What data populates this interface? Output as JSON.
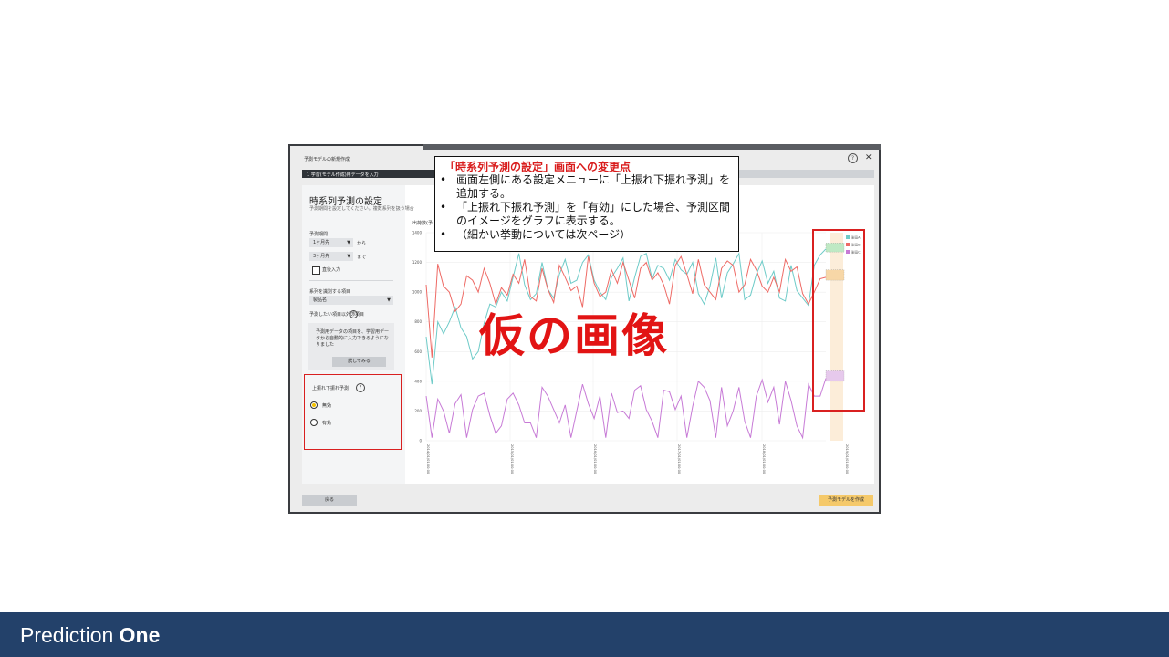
{
  "dialog": {
    "title": "予測モデルの新規作成",
    "step_label": "1 学習(モデル作成)用データを入力",
    "back_button": "戻る",
    "create_button": "予測モデルを作成"
  },
  "settings": {
    "title": "時系列予測の設定",
    "subtitle": "予測期間を設定してください。複数系列を扱う場合",
    "period_label": "予測期間",
    "period_from": "1ヶ月先",
    "from_suffix": "から",
    "period_to": "3ヶ月先",
    "to_suffix": "まで",
    "backtest_label": "直後入力",
    "series_label": "系列を識別する項目",
    "series_value": "製品名",
    "other_items_label": "予測したい項目以外の項目",
    "info_text": "予測用データの項目を、学習用データから自動的に入力できるようになりました",
    "try_button": "試してみる",
    "updown_label": "上振れ下振れ予測",
    "option_invalid": "無効",
    "option_valid": "有効"
  },
  "chart_label": "出荷数(予",
  "chart_data": {
    "type": "line",
    "ylabel": "出荷数(予",
    "ylim": [
      0,
      1400
    ],
    "yticks": [
      0,
      200,
      400,
      600,
      800,
      1000,
      1200,
      1400
    ],
    "xticks": [
      "2014/01/01 00:00",
      "2015/01/01 00:00",
      "2016/01/01 00:00",
      "2017/01/01 00:00",
      "2018/01/01 00:00",
      "2019/01/01 00:00"
    ],
    "grid": true,
    "legend_position": "top-right",
    "legend": [
      "製品A",
      "製品B",
      "製品C"
    ],
    "series": [
      {
        "name": "製品A",
        "color": "#6ecbc8",
        "values": [
          700,
          380,
          800,
          720,
          800,
          900,
          760,
          700,
          550,
          600,
          790,
          920,
          900,
          1000,
          940,
          1100,
          1260,
          1050,
          950,
          990,
          1200,
          1020,
          960,
          1120,
          1220,
          1060,
          1080,
          1200,
          1250,
          1080,
          1000,
          950,
          1100,
          1160,
          1230,
          940,
          1100,
          1240,
          1260,
          1090,
          1180,
          1160,
          1080,
          1220,
          1150,
          1120,
          1200,
          990,
          920,
          1040,
          1230,
          960,
          1130,
          1190,
          1260,
          950,
          980,
          1120,
          1210,
          1060,
          1140,
          960,
          940,
          1180,
          1010,
          960,
          910,
          1180,
          1250,
          1290
        ]
      },
      {
        "name": "製品B",
        "color": "#ee6a65",
        "values": [
          1050,
          560,
          1190,
          1040,
          1000,
          870,
          920,
          1110,
          1080,
          1000,
          1160,
          1060,
          920,
          1030,
          980,
          1120,
          1060,
          1220,
          970,
          940,
          1160,
          1020,
          930,
          1180,
          1100,
          1010,
          1040,
          900,
          1240,
          1060,
          970,
          1000,
          1150,
          1060,
          1200,
          1080,
          960,
          1160,
          1200,
          1080,
          1130,
          1050,
          920,
          1180,
          1240,
          1120,
          990,
          1220,
          1050,
          1000,
          950,
          1160,
          1210,
          1180,
          1000,
          1050,
          1220,
          1150,
          1040,
          1000,
          1100,
          1000,
          1220,
          1140,
          1170,
          990,
          920,
          1000,
          1090,
          1100
        ]
      },
      {
        "name": "製品C",
        "color": "#c77ad6",
        "values": [
          300,
          20,
          280,
          200,
          50,
          250,
          310,
          20,
          210,
          300,
          320,
          170,
          50,
          100,
          280,
          320,
          240,
          120,
          120,
          20,
          360,
          300,
          210,
          120,
          240,
          20,
          200,
          380,
          250,
          150,
          300,
          20,
          320,
          190,
          200,
          150,
          340,
          370,
          210,
          130,
          20,
          340,
          330,
          210,
          300,
          20,
          230,
          400,
          360,
          270,
          20,
          360,
          100,
          200,
          360,
          130,
          20,
          300,
          410,
          260,
          360,
          110,
          400,
          270,
          100,
          20,
          380,
          300,
          300,
          420
        ]
      }
    ],
    "forecast_band": {
      "A": [
        1270,
        1330
      ],
      "B": [
        1080,
        1150
      ],
      "C": [
        400,
        470
      ]
    }
  },
  "callout": {
    "title": "「時系列予測の設定」画面への変更点",
    "bullet": "•",
    "items": [
      "画面左側にある設定メニューに「上振れ下振れ予測」を追加する。",
      "「上振れ下振れ予測」を「有効」にした場合、予測区間のイメージをグラフに表示する。",
      "（細かい挙動については次ページ）"
    ]
  },
  "overlay_text": "仮の画像",
  "footer": {
    "brand_light": "Prediction",
    "brand_bold": "One",
    "color": "#23416a"
  }
}
